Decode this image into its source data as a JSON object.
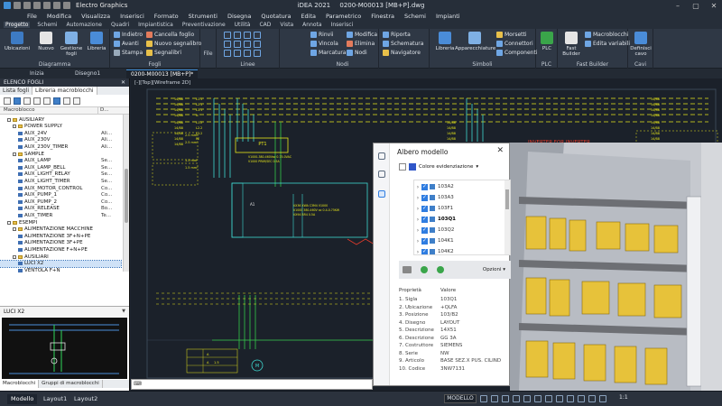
{
  "titlebar": {
    "app_name": "Electro Graphics",
    "title_left": "iDEA 2021",
    "title_right": "0200-M00013 [MB+P].dwg"
  },
  "menu": [
    "File",
    "Modifica",
    "Visualizza",
    "Inserisci",
    "Formato",
    "Strumenti",
    "Disegna",
    "Quotatura",
    "Edita",
    "Parametrico",
    "Finestra",
    "Schemi",
    "Impianti"
  ],
  "ribbon_tabs": [
    "Progetto",
    "Schemi",
    "Automazione",
    "Quadri",
    "Impiantistica",
    "Preventivazione",
    "Utilità",
    "CAD",
    "Vista",
    "Annota",
    "Inserisci"
  ],
  "ribbon": {
    "diagramma": {
      "label": "Diagramma",
      "buttons": [
        "Ubicazioni",
        "Nuovo",
        "Gestione fogli",
        "Libreria"
      ]
    },
    "fogli": {
      "label": "Fogli",
      "items": [
        "Indietro",
        "Avanti",
        "Stampa",
        "Cancella foglio",
        "Nuovo segnalibro",
        "Segnalibri"
      ]
    },
    "file": {
      "label": "File"
    },
    "linee": {
      "label": "Linee"
    },
    "nodi": {
      "label": "Nodi",
      "items": [
        "Rinvii",
        "Vincola",
        "Marcatura",
        "Modifica",
        "Elimina",
        "Nodi"
      ]
    },
    "riporta": {
      "items": [
        "Riporta",
        "Schematura",
        "Navigatore"
      ]
    },
    "simboli": {
      "label": "Simboli",
      "buttons": [
        "Libreria",
        "Apparecchiature"
      ],
      "items": [
        "Morsetti",
        "Connettori",
        "Componenti"
      ]
    },
    "plc": {
      "label": "PLC",
      "buttons": [
        "PLC"
      ]
    },
    "fast": {
      "label": "Fast Builder",
      "buttons": [
        "Fast Builder"
      ],
      "items": [
        "Macroblocchi",
        "Edita variabili"
      ]
    },
    "cavi": {
      "label": "Cavi",
      "buttons": [
        "Definisci cavo"
      ]
    }
  },
  "doc_tabs": [
    "Inizia",
    "Disegno1",
    "0200-M00013 [MB+P]*"
  ],
  "viewport_label": "[-][Top][Wireframe 2D]",
  "left_panel": {
    "header": "ELENCO FOGLI",
    "tabs": [
      "Lista fogli",
      "Libreria macroblocchi"
    ],
    "col_name": "Macroblocco",
    "col_desc": "D...",
    "tree": [
      {
        "label": "AUSILIARY",
        "type": "folder",
        "level": 1,
        "desc": ""
      },
      {
        "label": "POWER SUPPLY",
        "type": "folder",
        "level": 2,
        "desc": ""
      },
      {
        "label": "AUX_24V",
        "type": "item",
        "level": 3,
        "desc": "Ali..."
      },
      {
        "label": "AUX_230V",
        "type": "item",
        "level": 3,
        "desc": "Ali..."
      },
      {
        "label": "AUX_230V_TIMER",
        "type": "item",
        "level": 3,
        "desc": "Ali..."
      },
      {
        "label": "SAMPLE",
        "type": "folder",
        "level": 2,
        "desc": ""
      },
      {
        "label": "AUX_LAMP",
        "type": "item",
        "level": 3,
        "desc": "Se..."
      },
      {
        "label": "AUX_LAMP_BELL",
        "type": "item",
        "level": 3,
        "desc": "Se..."
      },
      {
        "label": "AUX_LIGHT_RELAY",
        "type": "item",
        "level": 3,
        "desc": "Se..."
      },
      {
        "label": "AUX_LIGHT_TIMER",
        "type": "item",
        "level": 3,
        "desc": "Se..."
      },
      {
        "label": "AUX_MOTOR_CONTROL",
        "type": "item",
        "level": 3,
        "desc": "Co..."
      },
      {
        "label": "AUX_PUMP_1",
        "type": "item",
        "level": 3,
        "desc": "Co..."
      },
      {
        "label": "AUX_PUMP_2",
        "type": "item",
        "level": 3,
        "desc": "Co..."
      },
      {
        "label": "AUX_RELEASE",
        "type": "item",
        "level": 3,
        "desc": "Bo..."
      },
      {
        "label": "AUX_TIMER",
        "type": "item",
        "level": 3,
        "desc": "Te..."
      },
      {
        "label": "ESEMPI",
        "type": "folder",
        "level": 1,
        "desc": ""
      },
      {
        "label": "ALIMENTAZIONE MACCHINE",
        "type": "folder",
        "level": 2,
        "desc": ""
      },
      {
        "label": "ALIMENTAZIONE 3F+N+PE",
        "type": "item",
        "level": 3,
        "desc": ""
      },
      {
        "label": "ALIMENTAZIONE 3F+PE",
        "type": "item",
        "level": 3,
        "desc": ""
      },
      {
        "label": "ALIMENTAZIONE F+N+PE",
        "type": "item",
        "level": 3,
        "desc": ""
      },
      {
        "label": "AUSILIARI",
        "type": "folder",
        "level": 2,
        "desc": ""
      },
      {
        "label": "LUCI X2",
        "type": "item",
        "level": 3,
        "desc": "",
        "selected": true
      },
      {
        "label": "VENTOLA F+N",
        "type": "item",
        "level": 3,
        "desc": ""
      }
    ],
    "preview_name": "LUCI X2",
    "bottom_tabs": [
      "Macroblocchi",
      "Gruppi di macroblocchi"
    ]
  },
  "model_panel": {
    "title": "Albero modello",
    "close": "✕",
    "color_label": "Colore evidenziazione",
    "items": [
      {
        "label": "103A2",
        "bold": false
      },
      {
        "label": "103A3",
        "bold": false
      },
      {
        "label": "103F1",
        "bold": false
      },
      {
        "label": "103Q1",
        "bold": true
      },
      {
        "label": "103Q2",
        "bold": false
      },
      {
        "label": "104K1",
        "bold": false
      },
      {
        "label": "104K2",
        "bold": false
      }
    ],
    "options_label": "Opzioni",
    "prop_header": "Proprietà",
    "value_header": "Valore",
    "properties": [
      {
        "k": "1. Sigla",
        "v": "103Q1"
      },
      {
        "k": "2. Ubicazione",
        "v": "+QLFA"
      },
      {
        "k": "3. Posizione",
        "v": "103/B2"
      },
      {
        "k": "4. Disegno",
        "v": "LAYOUT"
      },
      {
        "k": "5. Descrizione",
        "v": "14X51"
      },
      {
        "k": "6. Descrizione",
        "v": "GG 3A"
      },
      {
        "k": "7. Costruttore",
        "v": "SIEMENS"
      },
      {
        "k": "8. Serie",
        "v": "NW"
      },
      {
        "k": "9. Articolo",
        "v": "BASE SEZ.X PUS. CILIND"
      },
      {
        "k": "10. Codice",
        "v": "3NW7131"
      }
    ]
  },
  "drawing": {
    "left_labels": [
      "14/B8",
      "14/B8",
      "14/B8",
      "14/B8",
      "14/B8",
      "14/B8",
      "14/B8",
      "14/B8",
      "14/B8"
    ],
    "right_labels": [
      "14/B8",
      "14/B8",
      "14/B8",
      "14/B8",
      "14/B8",
      "14/B8",
      "14/B8",
      "14/B8"
    ],
    "mid_labels": [
      "14/B8",
      "14/B8",
      "14/B8",
      "14/B8"
    ],
    "wire_labels": [
      "L1.1",
      "L2.1",
      "L3.1",
      "N",
      "L1.2",
      "L2.2",
      "L3.2",
      "PE"
    ],
    "sections": [
      "2.5 mm²",
      "2.5 mm²",
      "1.5 mm²",
      "1.5 mm²"
    ],
    "pt_label": "PT1",
    "transformer_text": "V1000-380-460Vac 0.75-0VAC",
    "transformer_text2": "V1000 PRIM/SEC 0.5A",
    "panel_label": "A1",
    "inverter_text": "VX36 XWA C3M4 V1000",
    "inverter_text2": "V1000 380-460V ac 0.4-0.75KW",
    "inverter_text3": "VX94 BR4 0.5A",
    "red_text": "INVERTER FOR INVERTER",
    "motor_label": "M",
    "table_vals": [
      "A",
      "A",
      "1.5"
    ]
  },
  "status": {
    "tabs": [
      "Modello",
      "Layout1",
      "Layout2"
    ],
    "model_btn": "MODELLO",
    "scale": "1:1"
  }
}
